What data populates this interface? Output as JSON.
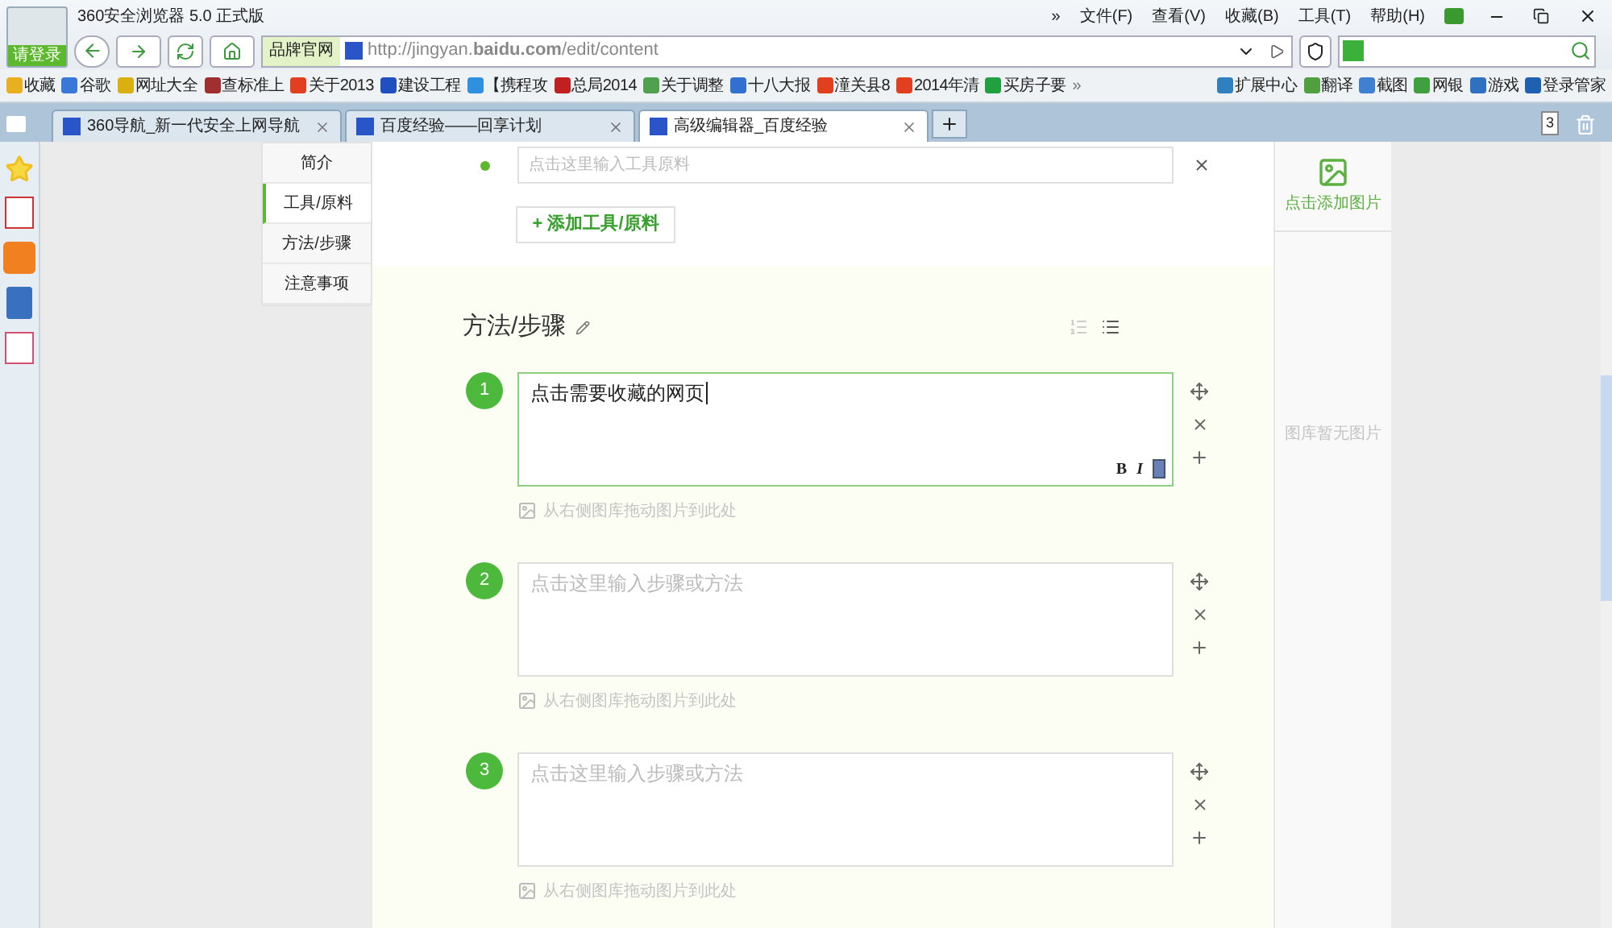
{
  "browser": {
    "title": "360安全浏览器 5.0 正式版",
    "login": "请登录",
    "menu": [
      "»",
      "文件(F)",
      "查看(V)",
      "收藏(B)",
      "工具(T)",
      "帮助(H)"
    ],
    "brand_button": "品牌官网",
    "url": "http://jingyan.**baidu.com**/edit/content",
    "bookmarks": [
      {
        "label": "收藏",
        "color": "#e8b020"
      },
      {
        "label": "谷歌",
        "color": "#3a78d8"
      },
      {
        "label": "网址大全",
        "color": "#d8b010"
      },
      {
        "label": "查标准上",
        "color": "#a03030"
      },
      {
        "label": "关于2013",
        "color": "#e04020"
      },
      {
        "label": "建设工程",
        "color": "#2050c0"
      },
      {
        "label": "【携程攻",
        "color": "#3090e0"
      },
      {
        "label": "总局2014",
        "color": "#c02020"
      },
      {
        "label": "关于调整",
        "color": "#50a050"
      },
      {
        "label": "十八大报",
        "color": "#3070d0"
      },
      {
        "label": "潼关县8",
        "color": "#e04020"
      },
      {
        "label": "2014年清",
        "color": "#e04020"
      },
      {
        "label": "买房子要",
        "color": "#20a040"
      }
    ],
    "more": "»",
    "extensions": [
      {
        "label": "扩展中心",
        "color": "#3080c0"
      },
      {
        "label": "翻译",
        "color": "#50a040"
      },
      {
        "label": "截图",
        "color": "#4080d0"
      },
      {
        "label": "网银",
        "color": "#40a040"
      },
      {
        "label": "游戏",
        "color": "#3070c0"
      },
      {
        "label": "登录管家",
        "color": "#2060b0"
      }
    ],
    "tabs": [
      {
        "label": "360导航_新一代安全上网导航",
        "selected": false
      },
      {
        "label": "百度经验——回享计划",
        "selected": false
      },
      {
        "label": "高级编辑器_百度经验",
        "selected": true
      }
    ],
    "tab_count": "3"
  },
  "page": {
    "nav": [
      {
        "label": "简介",
        "selected": false
      },
      {
        "label": "工具/原料",
        "selected": true
      },
      {
        "label": "方法/步骤",
        "selected": false
      },
      {
        "label": "注意事项",
        "selected": false
      }
    ],
    "tool_placeholder": "点击这里输入工具原料",
    "add_tool": "+ 添加工具/原料",
    "section_title": "方法/步骤",
    "steps": [
      {
        "number": "1",
        "value": "点击需要收藏的网页",
        "focused": true,
        "hint": "从右侧图库拖动图片到此处"
      },
      {
        "number": "2",
        "placeholder": "点击这里输入步骤或方法",
        "focused": false,
        "hint": "从右侧图库拖动图片到此处"
      },
      {
        "number": "3",
        "placeholder": "点击这里输入步骤或方法",
        "focused": false,
        "hint": "从右侧图库拖动图片到此处"
      }
    ],
    "format_buttons": [
      "B",
      "I"
    ],
    "gallery": {
      "add_label": "点击添加图片",
      "empty": "图库暂无图片"
    }
  }
}
